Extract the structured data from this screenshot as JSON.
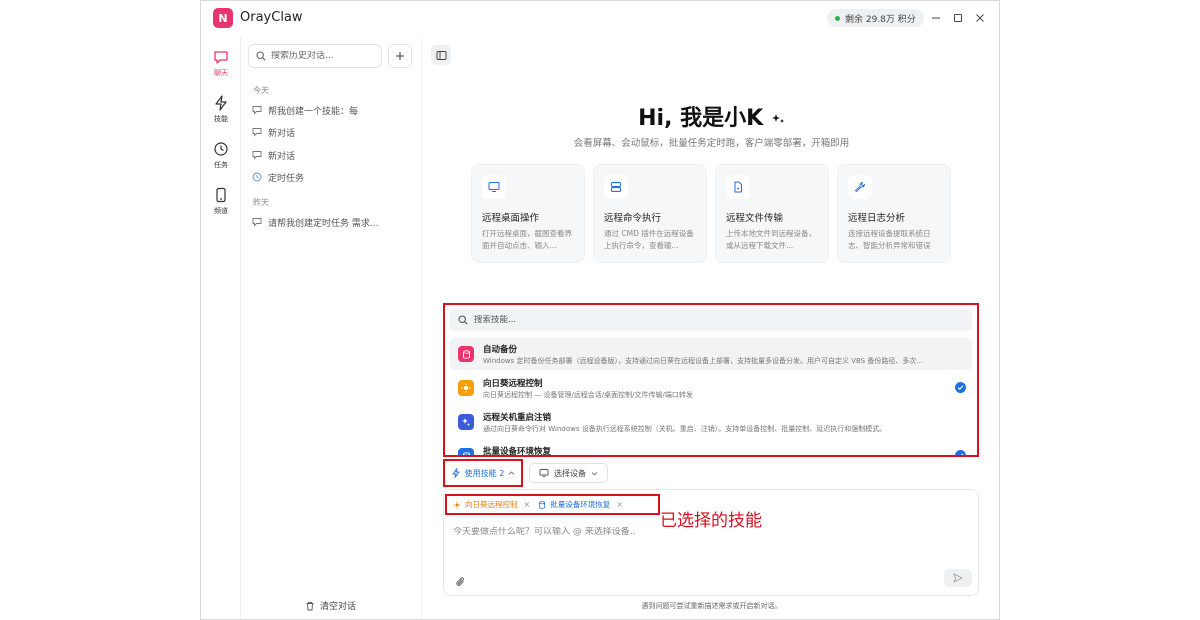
{
  "app": {
    "logo": "N",
    "title": "OrayClaw",
    "credit": "剩余 29.8万 积分"
  },
  "colors": {
    "brand": "#e8356d",
    "accent": "#1f6fe5",
    "highlight": "#d9101d"
  },
  "rail": [
    {
      "icon": "chat-icon",
      "label": "聊天",
      "active": true
    },
    {
      "icon": "lightning-icon",
      "label": "技能"
    },
    {
      "icon": "clock-icon",
      "label": "任务"
    },
    {
      "icon": "device-icon",
      "label": "频道"
    }
  ],
  "sidebar": {
    "search_placeholder": "搜索历史对话...",
    "today_label": "今天",
    "yesterday_label": "昨天",
    "today_items": [
      "帮我创建一个技能：每",
      "新对话",
      "新对话",
      "定时任务"
    ],
    "yesterday_items": [
      "请帮我创建定时任务 需求..."
    ],
    "clear_label": "清空对话"
  },
  "hero": {
    "title": "Hi, 我是小K",
    "subtitle": "会看屏幕、会动鼠标，批量任务定时跑，客户端零部署，开箱即用"
  },
  "cards": [
    {
      "icon": "monitor-icon",
      "title": "远程桌面操作",
      "desc": "打开远程桌面，截图查看界面并自动点击、输入..."
    },
    {
      "icon": "server-icon",
      "title": "远程命令执行",
      "desc": "通过 CMD 插件在远程设备上执行命令，查看输..."
    },
    {
      "icon": "file-icon",
      "title": "远程文件传输",
      "desc": "上传本地文件到远程设备，或从远程下载文件..."
    },
    {
      "icon": "wrench-icon",
      "title": "远程日志分析",
      "desc": "连接远程设备提取系统日志、智能分析异常和错误"
    }
  ],
  "skill_panel": {
    "search_placeholder": "搜索技能...",
    "items": [
      {
        "name": "自动备份",
        "desc": "Windows 定时备份任务部署（远程设备版），支持通过向日葵在远程设备上部署，支持批量多设备分发。用户可自定义 VBS 备份路径、多次...",
        "color": "#e8356d",
        "checked": false
      },
      {
        "name": "向日葵远程控制",
        "desc": "向日葵远程控制 — 设备管理/远程会话/桌面控制/文件传输/端口转发",
        "color": "#f59e0b",
        "checked": true
      },
      {
        "name": "远程关机重启注销",
        "desc": "通过向日葵命令行对 Windows 设备执行远程系统控制（关机、重启、注销）。支持单设备控制、批量控制、延迟执行和强制模式。",
        "color": "#3b5bdb",
        "checked": false
      },
      {
        "name": "批量设备环境恢复",
        "desc": "",
        "color": "#1f6fe5",
        "checked": true
      }
    ]
  },
  "toolbar": {
    "use_skill": "使用技能 2",
    "select_device": "选择设备"
  },
  "selected_skills": [
    {
      "name": "向日葵远程控制",
      "color": "#e8820c"
    },
    {
      "name": "批量设备环境恢复",
      "color": "#1f6fe5"
    }
  ],
  "annotation": "已选择的技能",
  "input": {
    "placeholder": "今天要做点什么呢？可以输入 @ 来选择设备.."
  },
  "footer": "遇到问题可尝试重新描述需求或开启新对话。"
}
